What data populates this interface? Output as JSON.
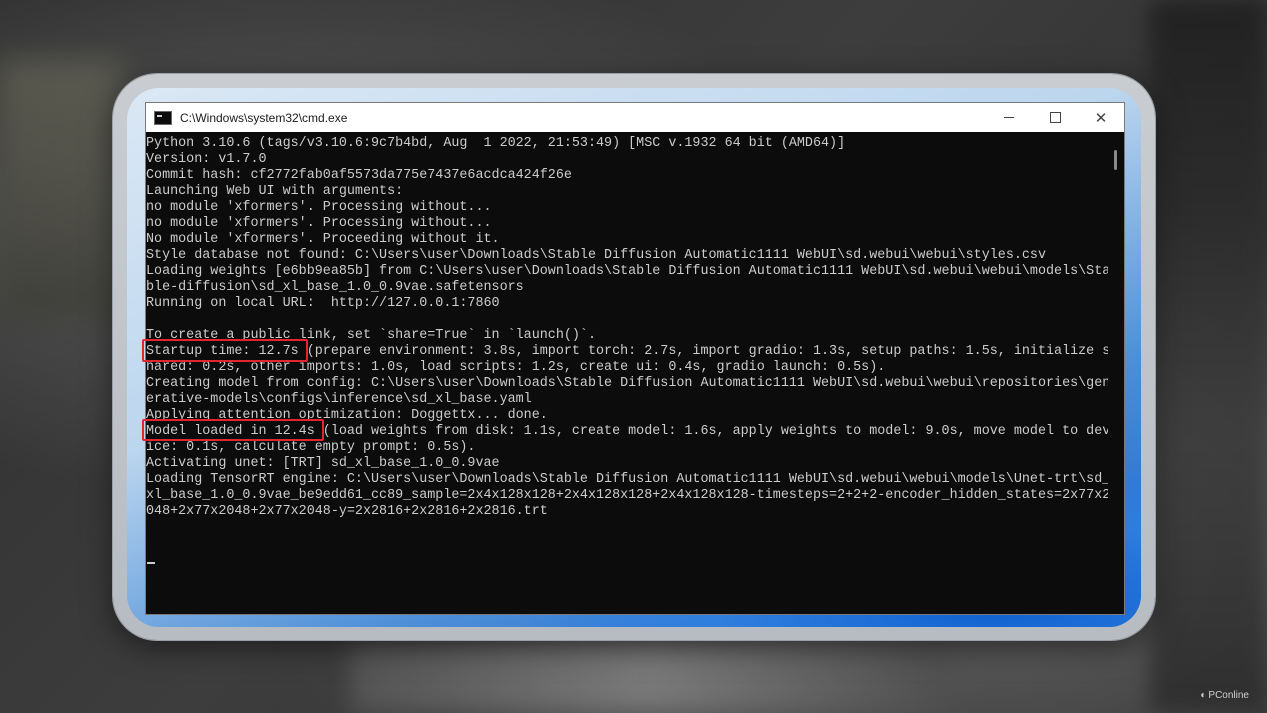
{
  "window": {
    "title": "C:\\Windows\\system32\\cmd.exe",
    "controls": [
      "minimize",
      "maximize",
      "close"
    ],
    "close_glyph": "✕"
  },
  "console": {
    "lines": [
      "Python 3.10.6 (tags/v3.10.6:9c7b4bd, Aug  1 2022, 21:53:49) [MSC v.1932 64 bit (AMD64)]",
      "Version: v1.7.0",
      "Commit hash: cf2772fab0af5573da775e7437e6acdca424f26e",
      "Launching Web UI with arguments:",
      "no module 'xformers'. Processing without...",
      "no module 'xformers'. Processing without...",
      "No module 'xformers'. Proceeding without it.",
      "Style database not found: C:\\Users\\user\\Downloads\\Stable Diffusion Automatic1111 WebUI\\sd.webui\\webui\\styles.csv",
      "Loading weights [e6bb9ea85b] from C:\\Users\\user\\Downloads\\Stable Diffusion Automatic1111 WebUI\\sd.webui\\webui\\models\\Sta",
      "ble-diffusion\\sd_xl_base_1.0_0.9vae.safetensors",
      "Running on local URL:  http://127.0.0.1:7860",
      "",
      "To create a public link, set `share=True` in `launch()`.",
      "Startup time: 12.7s (prepare environment: 3.8s, import torch: 2.7s, import gradio: 1.3s, setup paths: 1.5s, initialize s",
      "hared: 0.2s, other imports: 1.0s, load scripts: 1.2s, create ui: 0.4s, gradio launch: 0.5s).",
      "Creating model from config: C:\\Users\\user\\Downloads\\Stable Diffusion Automatic1111 WebUI\\sd.webui\\webui\\repositories\\gen",
      "erative-models\\configs\\inference\\sd_xl_base.yaml",
      "Applying attention optimization: Doggettx... done.",
      "Model loaded in 12.4s (load weights from disk: 1.1s, create model: 1.6s, apply weights to model: 9.0s, move model to dev",
      "ice: 0.1s, calculate empty prompt: 0.5s).",
      "Activating unet: [TRT] sd_xl_base_1.0_0.9vae",
      "Loading TensorRT engine: C:\\Users\\user\\Downloads\\Stable Diffusion Automatic1111 WebUI\\sd.webui\\webui\\models\\Unet-trt\\sd_",
      "xl_base_1.0_0.9vae_be9edd61_cc89_sample=2x4x128x128+2x4x128x128+2x4x128x128-timesteps=2+2+2-encoder_hidden_states=2x77x2",
      "048+2x77x2048+2x77x2048-y=2x2816+2x2816+2x2816.trt"
    ]
  },
  "highlights": [
    "Startup time: 12.7s",
    "Model loaded in 12.4s"
  ],
  "watermark": {
    "text": "PConline",
    "icon": "pconline-logo-icon"
  },
  "colors": {
    "console_bg": "#0c0c0c",
    "console_text": "#cccccc",
    "highlight": "#e3262e",
    "titlebar_bg": "#ffffff"
  }
}
